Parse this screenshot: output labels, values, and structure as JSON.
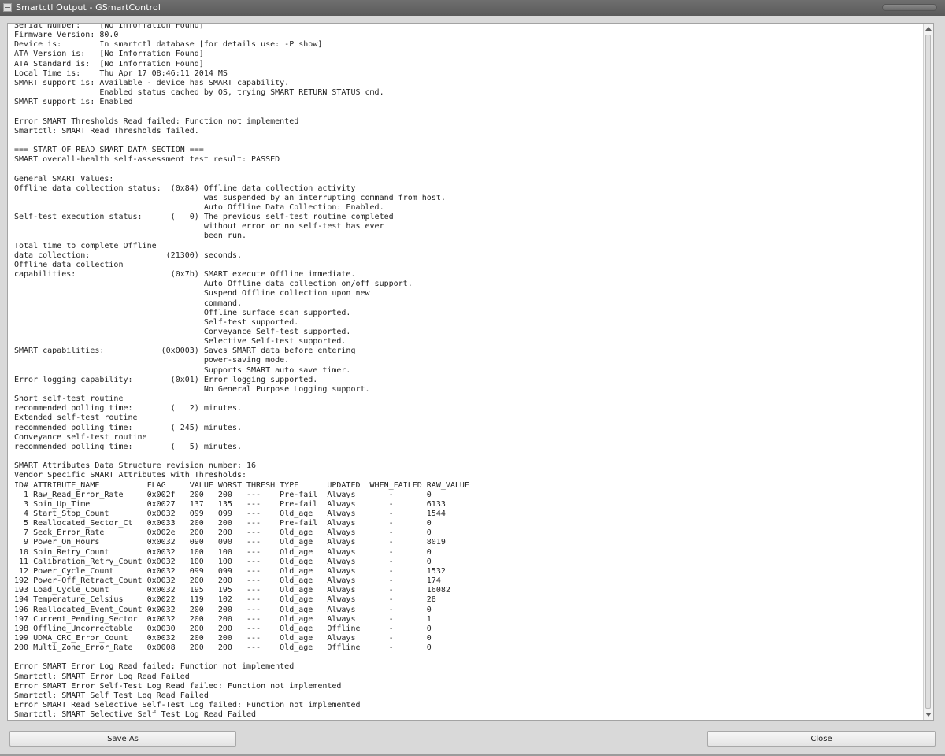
{
  "window": {
    "title": "Smartctl Output - GSmartControl"
  },
  "output": {
    "text": "Serial Number:    [No Information Found]\nFirmware Version: 80.0\nDevice is:        In smartctl database [for details use: -P show]\nATA Version is:   [No Information Found]\nATA Standard is:  [No Information Found]\nLocal Time is:    Thu Apr 17 08:46:11 2014 MS\nSMART support is: Available - device has SMART capability.\n                  Enabled status cached by OS, trying SMART RETURN STATUS cmd.\nSMART support is: Enabled\n\nError SMART Thresholds Read failed: Function not implemented\nSmartctl: SMART Read Thresholds failed.\n\n=== START OF READ SMART DATA SECTION ===\nSMART overall-health self-assessment test result: PASSED\n\nGeneral SMART Values:\nOffline data collection status:  (0x84) Offline data collection activity\n                                        was suspended by an interrupting command from host.\n                                        Auto Offline Data Collection: Enabled.\nSelf-test execution status:      (   0) The previous self-test routine completed\n                                        without error or no self-test has ever\n                                        been run.\nTotal time to complete Offline\ndata collection:                (21300) seconds.\nOffline data collection\ncapabilities:                    (0x7b) SMART execute Offline immediate.\n                                        Auto Offline data collection on/off support.\n                                        Suspend Offline collection upon new\n                                        command.\n                                        Offline surface scan supported.\n                                        Self-test supported.\n                                        Conveyance Self-test supported.\n                                        Selective Self-test supported.\nSMART capabilities:            (0x0003) Saves SMART data before entering\n                                        power-saving mode.\n                                        Supports SMART auto save timer.\nError logging capability:        (0x01) Error logging supported.\n                                        No General Purpose Logging support.\nShort self-test routine\nrecommended polling time:        (   2) minutes.\nExtended self-test routine\nrecommended polling time:        ( 245) minutes.\nConveyance self-test routine\nrecommended polling time:        (   5) minutes.\n\nSMART Attributes Data Structure revision number: 16\nVendor Specific SMART Attributes with Thresholds:\nID# ATTRIBUTE_NAME          FLAG     VALUE WORST THRESH TYPE      UPDATED  WHEN_FAILED RAW_VALUE\n  1 Raw_Read_Error_Rate     0x002f   200   200   ---    Pre-fail  Always       -       0\n  3 Spin_Up_Time            0x0027   137   135   ---    Pre-fail  Always       -       6133\n  4 Start_Stop_Count        0x0032   099   099   ---    Old_age   Always       -       1544\n  5 Reallocated_Sector_Ct   0x0033   200   200   ---    Pre-fail  Always       -       0\n  7 Seek_Error_Rate         0x002e   200   200   ---    Old_age   Always       -       0\n  9 Power_On_Hours          0x0032   090   090   ---    Old_age   Always       -       8019\n 10 Spin_Retry_Count        0x0032   100   100   ---    Old_age   Always       -       0\n 11 Calibration_Retry_Count 0x0032   100   100   ---    Old_age   Always       -       0\n 12 Power_Cycle_Count       0x0032   099   099   ---    Old_age   Always       -       1532\n192 Power-Off_Retract_Count 0x0032   200   200   ---    Old_age   Always       -       174\n193 Load_Cycle_Count        0x0032   195   195   ---    Old_age   Always       -       16082\n194 Temperature_Celsius     0x0022   119   102   ---    Old_age   Always       -       28\n196 Reallocated_Event_Count 0x0032   200   200   ---    Old_age   Always       -       0\n197 Current_Pending_Sector  0x0032   200   200   ---    Old_age   Always       -       1\n198 Offline_Uncorrectable   0x0030   200   200   ---    Old_age   Offline      -       0\n199 UDMA_CRC_Error_Count    0x0032   200   200   ---    Old_age   Always       -       0\n200 Multi_Zone_Error_Rate   0x0008   200   200   ---    Old_age   Offline      -       0\n\nError SMART Error Log Read failed: Function not implemented\nSmartctl: SMART Error Log Read Failed\nError SMART Error Self-Test Log Read failed: Function not implemented\nSmartctl: SMART Self Test Log Read Failed\nError SMART Read Selective Self-Test Log failed: Function not implemented\nSmartctl: SMART Selective Self Test Log Read Failed"
  },
  "buttons": {
    "save_as": "Save As",
    "close": "Close"
  }
}
